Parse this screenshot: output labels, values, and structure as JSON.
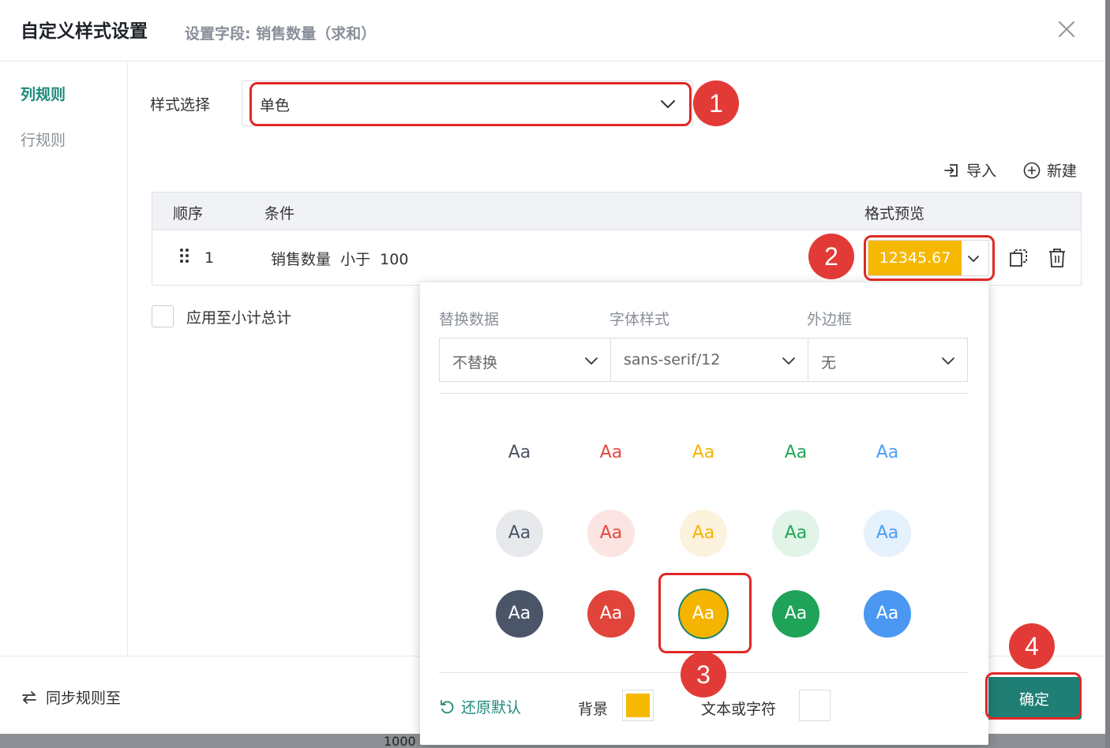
{
  "dialog": {
    "title": "自定义样式设置",
    "subtitle": "设置字段: 销售数量（求和）"
  },
  "nav": {
    "items": [
      {
        "label": "列规则",
        "active": true
      },
      {
        "label": "行规则",
        "active": false
      }
    ]
  },
  "style_select": {
    "label": "样式选择",
    "value": "单色"
  },
  "actions": {
    "import": "导入",
    "new": "新建"
  },
  "table": {
    "headers": [
      "顺序",
      "条件",
      "格式预览"
    ],
    "rows": [
      {
        "order": "1",
        "condition": "销售数量  小于  100",
        "preview": "12345.67"
      }
    ]
  },
  "apply_checkbox": {
    "label": "应用至小计总计",
    "checked": false
  },
  "popup": {
    "replace_label": "替换数据",
    "replace_value": "不替换",
    "font_label": "字体样式",
    "font_value": "sans-serif/12",
    "border_label": "外边框",
    "border_value": "无",
    "swatch_text": "Aa",
    "reset": "还原默认",
    "background_label": "背景",
    "text_label": "文本或字符"
  },
  "footer": {
    "sync": "同步规则至",
    "confirm": "确定"
  },
  "annotations": [
    "1",
    "2",
    "3",
    "4"
  ],
  "underlay_text": "1000",
  "colors": {
    "accent": "#1f7f74",
    "selected_bg": "#f6b800",
    "annotation": "#e02826",
    "swatch_text": [
      "#4a5568",
      "#e5483e",
      "#f4b400",
      "#20a85a",
      "#4a9ef5"
    ],
    "swatch_light_bg": [
      "#e7e9ec",
      "#fbe4e2",
      "#fdf2dd",
      "#e2f3e8",
      "#e5f1fd"
    ],
    "swatch_solid_bg": [
      "#4a5568",
      "#e0443a",
      "#f4b400",
      "#1fa358",
      "#4a98f2"
    ]
  }
}
